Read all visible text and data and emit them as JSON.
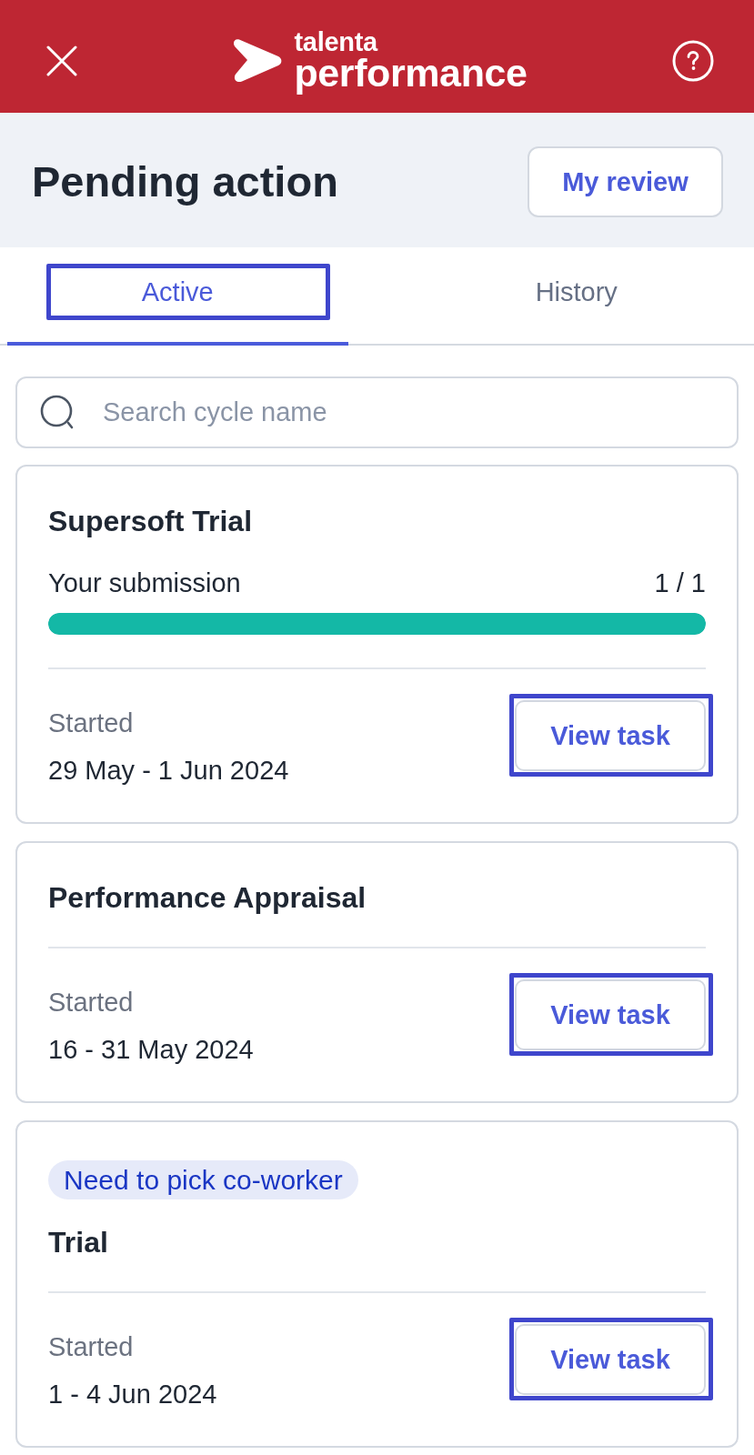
{
  "header": {
    "logo": {
      "line_1": "talenta",
      "line_2": "performance"
    }
  },
  "page_header": {
    "title": "Pending action",
    "button": "My review"
  },
  "tabs": [
    {
      "label": "Active",
      "selected": true,
      "highlighted": true
    },
    {
      "label": "History",
      "selected": false,
      "highlighted": false
    }
  ],
  "search": {
    "placeholder": "Search cycle name"
  },
  "cards": [
    {
      "title": "Supersoft Trial",
      "progress": {
        "label": "Your submission",
        "reading": "1 / 1",
        "level": 1
      },
      "started_label": "Started",
      "dates": "29 May - 1 Jun 2024",
      "button": {
        "label": "View task",
        "highlighted": true
      }
    },
    {
      "title": "Performance Appraisal",
      "started_label": "Started",
      "dates": "16 - 31 May 2024",
      "button": {
        "label": "View task",
        "highlighted": true
      }
    },
    {
      "badge": "Need to pick co-worker",
      "title": "Trial",
      "started_label": "Started",
      "dates": "1 - 4 Jun 2024",
      "button": {
        "label": "View task",
        "highlighted": true
      }
    }
  ]
}
